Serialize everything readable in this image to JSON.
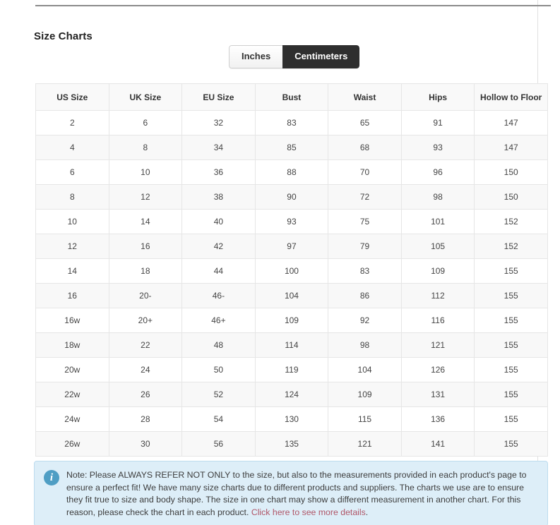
{
  "section": {
    "title": "Size Charts"
  },
  "unit_toggle": {
    "options": [
      {
        "label": "Inches",
        "active": false
      },
      {
        "label": "Centimeters",
        "active": true
      }
    ],
    "selected": "Centimeters"
  },
  "table": {
    "headers": [
      "US Size",
      "UK Size",
      "EU Size",
      "Bust",
      "Waist",
      "Hips",
      "Hollow to Floor"
    ],
    "rows": [
      [
        "2",
        "6",
        "32",
        "83",
        "65",
        "91",
        "147"
      ],
      [
        "4",
        "8",
        "34",
        "85",
        "68",
        "93",
        "147"
      ],
      [
        "6",
        "10",
        "36",
        "88",
        "70",
        "96",
        "150"
      ],
      [
        "8",
        "12",
        "38",
        "90",
        "72",
        "98",
        "150"
      ],
      [
        "10",
        "14",
        "40",
        "93",
        "75",
        "101",
        "152"
      ],
      [
        "12",
        "16",
        "42",
        "97",
        "79",
        "105",
        "152"
      ],
      [
        "14",
        "18",
        "44",
        "100",
        "83",
        "109",
        "155"
      ],
      [
        "16",
        "20-",
        "46-",
        "104",
        "86",
        "112",
        "155"
      ],
      [
        "16w",
        "20+",
        "46+",
        "109",
        "92",
        "116",
        "155"
      ],
      [
        "18w",
        "22",
        "48",
        "114",
        "98",
        "121",
        "155"
      ],
      [
        "20w",
        "24",
        "50",
        "119",
        "104",
        "126",
        "155"
      ],
      [
        "22w",
        "26",
        "52",
        "124",
        "109",
        "131",
        "155"
      ],
      [
        "24w",
        "28",
        "54",
        "130",
        "115",
        "136",
        "155"
      ],
      [
        "26w",
        "30",
        "56",
        "135",
        "121",
        "141",
        "155"
      ]
    ]
  },
  "note": {
    "icon": "info-icon",
    "icon_glyph": "i",
    "text": "Note: Please ALWAYS REFER NOT ONLY to the size, but also to the measurements provided in each product's page to ensure a perfect fit! We have many size charts due to different products and suppliers. The charts we use are to ensure they fit true to size and body shape. The size in one chart may show a different measurement in another chart. For this reason, please check the chart in each product. ",
    "link_label": "Click here to see more details",
    "link_suffix": "."
  },
  "colors": {
    "note_background": "#ddeef8",
    "note_border": "#bcdcee",
    "note_icon": "#4f9ec4",
    "note_link": "#b05668",
    "toggle_active_background": "#2f2f2f",
    "table_header_background": "#f9f9f9",
    "table_stripe_background": "#f8f8f8",
    "table_border": "#e6e6e6"
  }
}
